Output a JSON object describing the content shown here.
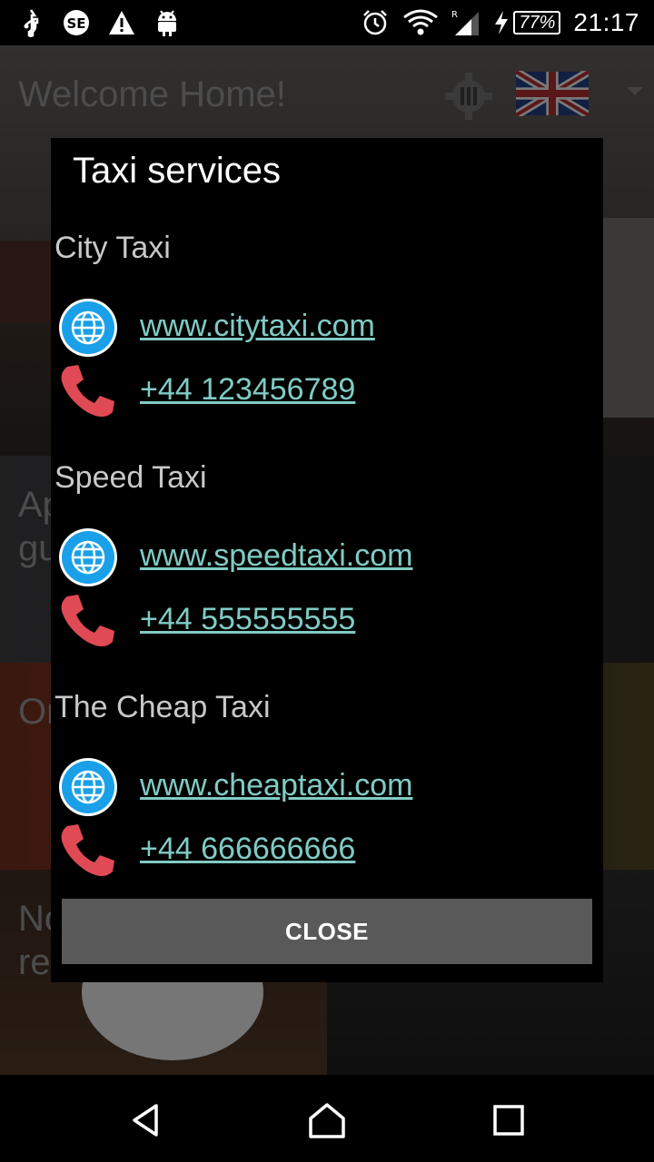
{
  "status_bar": {
    "time": "21:17",
    "battery_percent": "77%",
    "icons": [
      "usb-icon",
      "se-icon",
      "warning-icon",
      "android-icon",
      "alarm-icon",
      "wifi-icon",
      "signal-icon",
      "charging-icon"
    ]
  },
  "background": {
    "title": "Welcome Home!",
    "tile1_text": "Ap\ngu",
    "tile2_text": "Or",
    "tile3_text": "No\nre"
  },
  "dialog": {
    "title": "Taxi services",
    "companies": [
      {
        "name": "City Taxi",
        "website": "www.citytaxi.com",
        "phone": "+44 123456789"
      },
      {
        "name": "Speed Taxi",
        "website": "www.speedtaxi.com",
        "phone": "+44 555555555"
      },
      {
        "name": "The Cheap Taxi",
        "website": "www.cheaptaxi.com",
        "phone": "+44 666666666"
      }
    ],
    "close_label": "CLOSE"
  },
  "colors": {
    "link": "#80cbc4",
    "globe": "#1aa0e8",
    "phone": "#e04a55",
    "button": "#595959"
  }
}
